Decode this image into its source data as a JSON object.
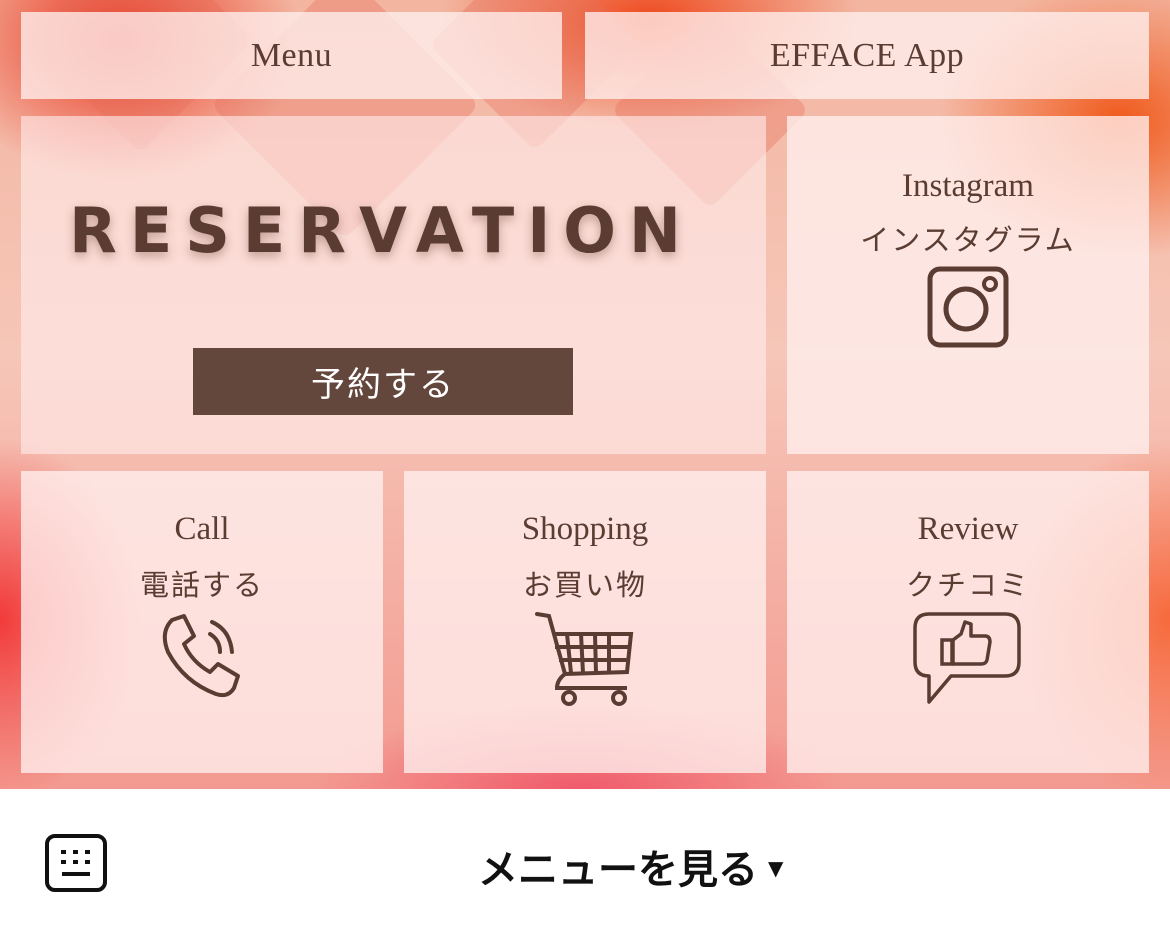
{
  "rich_menu": {
    "top_buttons": [
      {
        "label": "Menu"
      },
      {
        "label": "EFFACE App"
      }
    ],
    "reservation": {
      "title": "RESERVATION",
      "button_label": "予約する"
    },
    "tiles": {
      "instagram": {
        "label_en": "Instagram",
        "label_jp": "インスタグラム",
        "icon": "instagram-icon"
      },
      "call": {
        "label_en": "Call",
        "label_jp": "電話する",
        "icon": "phone-icon"
      },
      "shopping": {
        "label_en": "Shopping",
        "label_jp": "お買い物",
        "icon": "shopping-cart-icon"
      },
      "review": {
        "label_en": "Review",
        "label_jp": "クチコミ",
        "icon": "thumbs-up-bubble-icon"
      }
    },
    "colors": {
      "text_brown": "#5a3c32",
      "button_brown": "#64473c",
      "tile_overlay": "#fff0ee"
    }
  },
  "bottom_bar": {
    "keyboard_icon": "keyboard-icon",
    "toggle_label": "メニューを見る",
    "toggle_caret": "▼"
  }
}
